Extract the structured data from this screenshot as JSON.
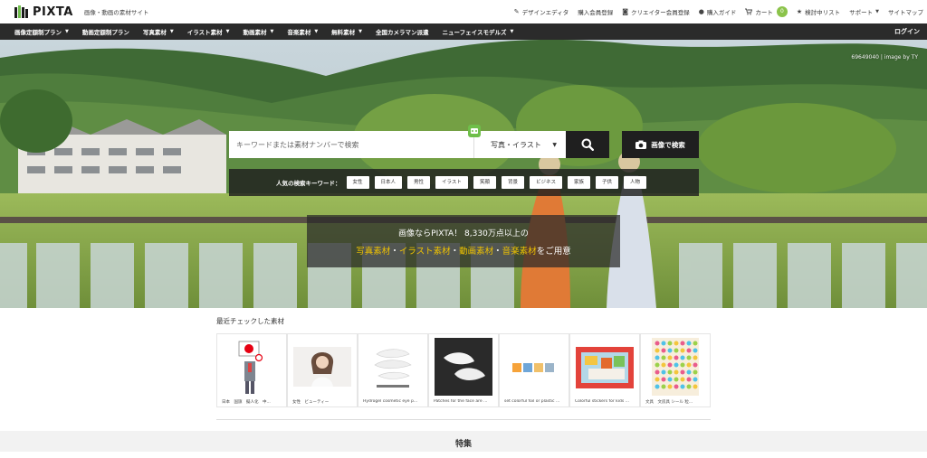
{
  "header": {
    "logo_text": "PIXTA",
    "tagline": "画像・動画の素材サイト",
    "util": [
      {
        "icon": "pencil-square-icon",
        "glyph": "✎",
        "label": "デザインエディタ"
      },
      {
        "icon": "",
        "glyph": "",
        "label": "購入会員登録"
      },
      {
        "icon": "camera-icon",
        "glyph": "◙",
        "label": "クリエイター会員登録"
      },
      {
        "icon": "info-icon",
        "glyph": "●",
        "label": "購入ガイド"
      },
      {
        "icon": "cart-icon",
        "glyph": "🛒",
        "label": "カート"
      },
      {
        "icon": "star-icon",
        "glyph": "★",
        "label": "検討中リスト"
      },
      {
        "icon": "",
        "glyph": "",
        "label": "サポート"
      },
      {
        "icon": "",
        "glyph": "",
        "label": "サイトマップ"
      }
    ],
    "cart_count": "0"
  },
  "catnav": {
    "items": [
      {
        "label": "画像定額制プラン",
        "caret": true
      },
      {
        "label": "動画定額制プラン",
        "caret": false
      },
      {
        "label": "写真素材",
        "caret": true
      },
      {
        "label": "イラスト素材",
        "caret": true
      },
      {
        "label": "動画素材",
        "caret": true
      },
      {
        "label": "音楽素材",
        "caret": true
      },
      {
        "label": "無料素材",
        "caret": true
      },
      {
        "label": "全国カメラマン派遣",
        "caret": false
      },
      {
        "label": "ニューフェイスモデルズ",
        "caret": true
      }
    ],
    "login": "ログイン"
  },
  "hero": {
    "credit": "69649040 | image by TY",
    "search": {
      "placeholder": "キーワードまたは素材ナンバーで検索",
      "type_label": "写真・イラスト"
    },
    "image_search_label": "画像で検索",
    "popular_label": "人気の検索キーワード：",
    "popular_tags": [
      "女性",
      "日本人",
      "男性",
      "イラスト",
      "笑顔",
      "背景",
      "ビジネス",
      "家族",
      "子供",
      "人物"
    ],
    "promo": {
      "line1": "画像ならPIXTA！ 8,330万点以上の",
      "photo": "写真素材",
      "sep1": "・",
      "illust": "イラスト素材",
      "sep2": "・",
      "video": "動画素材",
      "sep3": "・",
      "music": "音楽素材",
      "tail": "をご用意"
    }
  },
  "recent": {
    "title": "最近チェックした素材",
    "items": [
      {
        "caption": "日本　国旗　擬人化　中..."
      },
      {
        "caption": "女性　ビューティー"
      },
      {
        "caption": "Hydrogel cosmetic eye p..."
      },
      {
        "caption": "Patches for the face are ..."
      },
      {
        "caption": "set colorful foil or plastic ..."
      },
      {
        "caption": "Colorful stickers for kids ..."
      },
      {
        "caption": "文具　文房具 シール 粒..."
      }
    ]
  },
  "features_title": "特集",
  "colors": {
    "nav_bg": "#2b2b2b",
    "accent_green": "#8bc34a",
    "promo_highlight": "#f2c400",
    "search_button": "#1f1f1f"
  }
}
